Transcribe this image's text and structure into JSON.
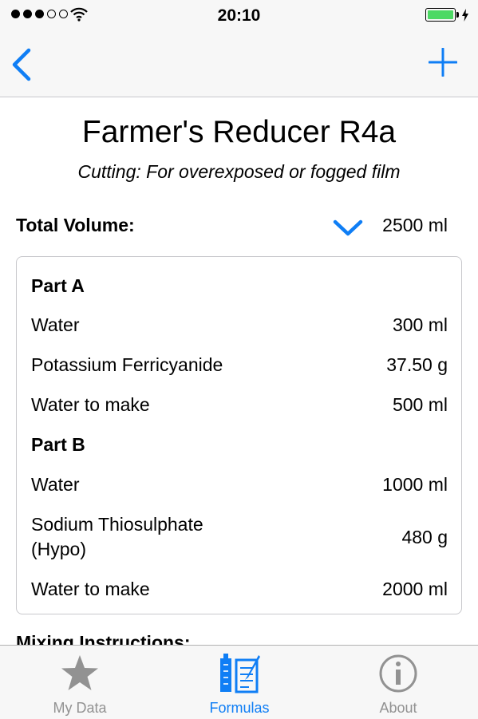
{
  "status_bar": {
    "time": "20:10"
  },
  "formula": {
    "title": "Farmer's Reducer R4a",
    "subtitle": "Cutting: For overexposed or fogged film"
  },
  "volume": {
    "label": "Total Volume:",
    "value": "2500 ml"
  },
  "part_a": {
    "heading": "Part A",
    "rows": [
      {
        "name": "Water",
        "amount": "300 ml"
      },
      {
        "name": "Potassium Ferricyanide",
        "amount": "37.50 g"
      },
      {
        "name": "Water to make",
        "amount": "500 ml"
      }
    ]
  },
  "part_b": {
    "heading": "Part B",
    "rows": [
      {
        "name": "Water",
        "amount": "1000 ml"
      },
      {
        "name": "Sodium Thiosulphate",
        "name_line2": "(Hypo)",
        "amount": "480 g"
      },
      {
        "name": "Water to make",
        "amount": "2000 ml"
      }
    ]
  },
  "mixing": {
    "heading": "Mixing Instructions:"
  },
  "tabs": [
    {
      "label": "My Data",
      "icon": "star-icon",
      "active": false
    },
    {
      "label": "Formulas",
      "icon": "formulas-icon",
      "active": true
    },
    {
      "label": "About",
      "icon": "info-icon",
      "active": false
    }
  ],
  "colors": {
    "accent": "#0f7ef5",
    "inactive": "#929292",
    "battery": "#4cd964"
  }
}
